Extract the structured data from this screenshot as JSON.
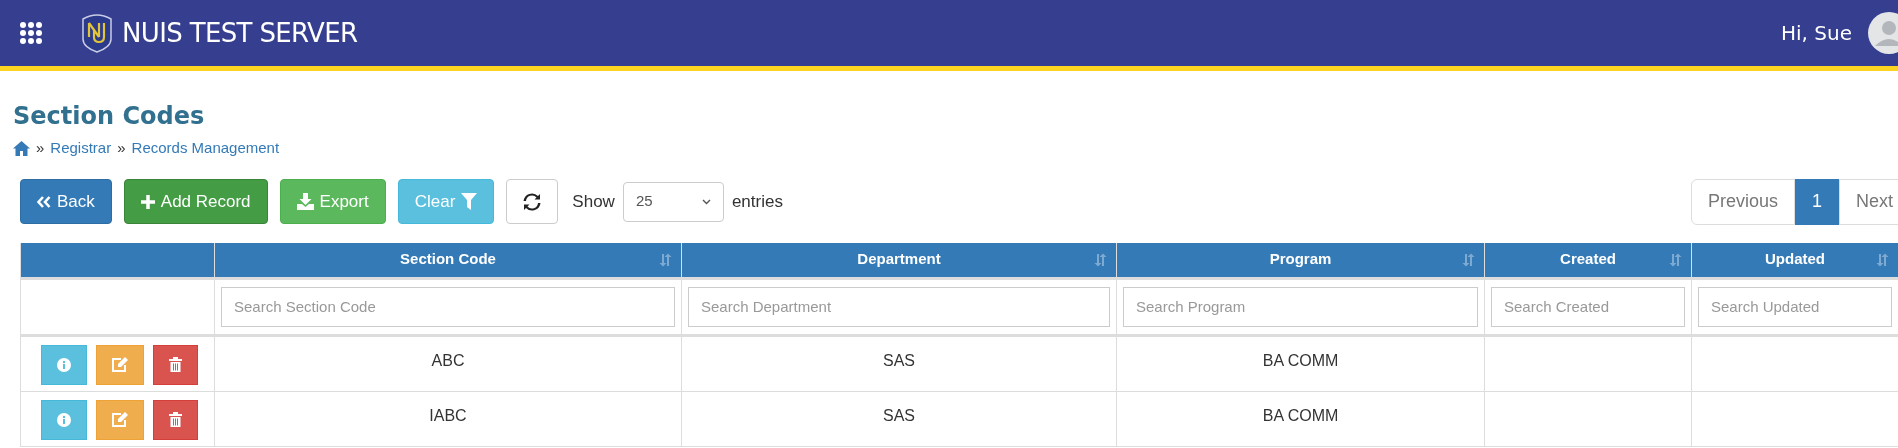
{
  "header": {
    "title": "NUIS TEST SERVER",
    "greeting": "Hi, Sue"
  },
  "page": {
    "title": "Section Codes"
  },
  "breadcrumb": [
    {
      "separator": "»",
      "label": "Registrar"
    },
    {
      "separator": "»",
      "label": "Records Management"
    }
  ],
  "toolbar": {
    "buttons": [
      {
        "kind": "back",
        "label": "Back"
      },
      {
        "kind": "add",
        "label": "Add Record"
      },
      {
        "kind": "export",
        "label": "Export"
      },
      {
        "kind": "clear",
        "label": "Clear"
      },
      {
        "kind": "refresh"
      }
    ],
    "show_label": "Show",
    "page_size": "25",
    "entries_label": "entries"
  },
  "pagination": [
    {
      "label": "Previous",
      "selected": false
    },
    {
      "label": "1",
      "selected": true
    },
    {
      "label": "Next",
      "selected": false
    }
  ],
  "table": {
    "columns": [
      {
        "label": "Section Code",
        "placeholder": "Search Section Code"
      },
      {
        "label": "Department",
        "placeholder": "Search Department"
      },
      {
        "label": "Program",
        "placeholder": "Search Program"
      },
      {
        "label": "Created",
        "placeholder": "Search Created"
      },
      {
        "label": "Updated",
        "placeholder": "Search Updated"
      }
    ],
    "rows": [
      {
        "cells": [
          "ABC",
          "SAS",
          "BA COMM"
        ]
      },
      {
        "cells": [
          "IABC",
          "SAS",
          "BA COMM"
        ]
      }
    ]
  }
}
